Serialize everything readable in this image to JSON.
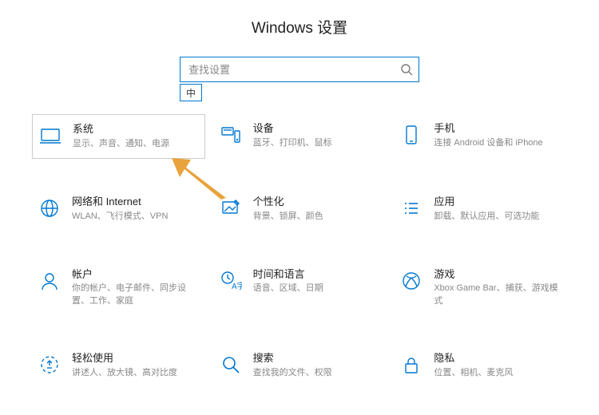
{
  "title": "Windows 设置",
  "search": {
    "placeholder": "查找设置"
  },
  "ime": "中",
  "tiles": [
    {
      "id": "system",
      "title": "系统",
      "desc": "显示、声音、通知、电源"
    },
    {
      "id": "devices",
      "title": "设备",
      "desc": "蓝牙、打印机、鼠标"
    },
    {
      "id": "phone",
      "title": "手机",
      "desc": "连接 Android 设备和 iPhone"
    },
    {
      "id": "network",
      "title": "网络和 Internet",
      "desc": "WLAN、飞行模式、VPN"
    },
    {
      "id": "personalization",
      "title": "个性化",
      "desc": "背景、锁屏、颜色"
    },
    {
      "id": "apps",
      "title": "应用",
      "desc": "卸载、默认应用、可选功能"
    },
    {
      "id": "accounts",
      "title": "帐户",
      "desc": "你的帐户、电子邮件、同步设置、工作、家庭"
    },
    {
      "id": "time",
      "title": "时间和语言",
      "desc": "语音、区域、日期"
    },
    {
      "id": "gaming",
      "title": "游戏",
      "desc": "Xbox Game Bar、捕获、游戏模式"
    },
    {
      "id": "ease",
      "title": "轻松使用",
      "desc": "讲述人、放大镜、高对比度"
    },
    {
      "id": "search-tile",
      "title": "搜索",
      "desc": "查找我的文件、权限"
    },
    {
      "id": "privacy",
      "title": "隐私",
      "desc": "位置、相机、麦克风"
    }
  ]
}
